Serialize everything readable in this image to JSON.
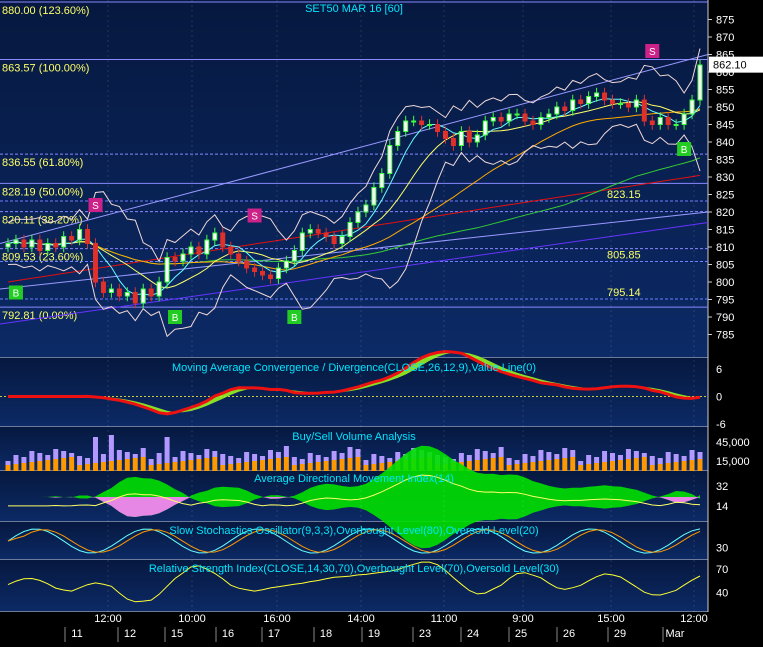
{
  "chart_data": [
    {
      "type": "candlestick",
      "title": "SET50 MAR 16  [60]",
      "ylim": [
        780,
        880
      ],
      "yticks": [
        785,
        790,
        795,
        800,
        805,
        810,
        815,
        820,
        825,
        830,
        835,
        840,
        845,
        850,
        855,
        860,
        865,
        870,
        875
      ],
      "last_price": "862.10",
      "fibonacci": [
        {
          "label": "880.00 (123.60%)",
          "value": 880.0
        },
        {
          "label": "863.57 (100.00%)",
          "value": 863.57
        },
        {
          "label": "836.55 (61.80%)",
          "value": 836.55
        },
        {
          "label": "828.19 (50.00%)",
          "value": 828.19
        },
        {
          "label": "820.11 (38.20%)",
          "value": 820.11
        },
        {
          "label": "809.53 (23.60%)",
          "value": 809.53
        },
        {
          "label": "792.81 (0.00%)",
          "value": 792.81
        }
      ],
      "levels": [
        {
          "label": "823.15",
          "value": 823.15
        },
        {
          "label": "805.85",
          "value": 805.85
        },
        {
          "label": "795.14",
          "value": 795.14
        }
      ],
      "close": [
        811,
        812,
        810,
        812,
        809,
        811,
        810,
        813,
        812,
        815,
        811,
        800,
        797,
        798,
        796,
        797,
        794,
        798,
        796,
        800,
        807,
        806,
        808,
        810,
        808,
        812,
        814,
        810,
        808,
        806,
        804,
        803,
        802,
        801,
        804,
        806,
        809,
        814,
        815,
        814,
        813,
        811,
        813,
        817,
        820,
        822,
        827,
        831,
        839,
        843,
        846,
        846,
        845,
        845,
        843,
        841,
        839,
        843,
        840,
        842,
        846,
        847,
        846,
        848,
        848,
        846,
        845,
        847,
        848,
        850,
        849,
        852,
        851,
        853,
        854,
        852,
        851,
        851,
        850,
        852,
        846,
        845,
        847,
        845,
        845,
        848,
        852,
        862
      ],
      "signals": [
        {
          "label": "B",
          "index": 1,
          "value": 797
        },
        {
          "label": "S",
          "index": 11,
          "value": 822
        },
        {
          "label": "B",
          "index": 21,
          "value": 790
        },
        {
          "label": "S",
          "index": 31,
          "value": 819
        },
        {
          "label": "B",
          "index": 36,
          "value": 790
        },
        {
          "label": "S",
          "index": 81,
          "value": 866
        },
        {
          "label": "B",
          "index": 85,
          "value": 838
        }
      ]
    },
    {
      "type": "area",
      "title": "Moving Average Convergence / Divergence(CLOSE,26,12,9),Value Line(0)",
      "ylim": [
        -6,
        6
      ],
      "yticks": [
        6,
        0,
        -6
      ]
    },
    {
      "type": "bar",
      "title": "Buy/Sell Volume Analysis",
      "yticks": [
        "45,000",
        "15,000"
      ]
    },
    {
      "type": "area",
      "title": "Average Directional Movement Index(14)",
      "yticks": [
        32,
        14
      ]
    },
    {
      "type": "line",
      "title": "Slow Stochastics Oscillator(9,3,3),Overbought Level(80),Oversold Level(20)",
      "yticks": [
        30
      ]
    },
    {
      "type": "line",
      "title": "Relative Strength Index(CLOSE,14,30,70),Overbought Level(70),Oversold Level(30)",
      "yticks": [
        70,
        40
      ]
    }
  ],
  "xaxis": {
    "times": [
      "12:00",
      "10:00",
      "16:00",
      "14:00",
      "11:00",
      "9:00",
      "15:00",
      "12:00"
    ],
    "dates": [
      "11",
      "12",
      "15",
      "16",
      "17",
      "18",
      "19",
      "23",
      "24",
      "25",
      "26",
      "29",
      "Mar"
    ]
  },
  "colors": {
    "background": "#0c2a66",
    "up_candle": "#3fff3f",
    "down_candle": "#e0302a",
    "fib_line": "#8888ff",
    "buy_signal": "#22cc22",
    "sell_signal": "#cc2288",
    "macd_positive": "#a0ff20",
    "macd_negative": "#ee1111",
    "adx_plus": "#00e000",
    "adx_minus": "#ff80ff",
    "title_text": "#00e5ff"
  }
}
